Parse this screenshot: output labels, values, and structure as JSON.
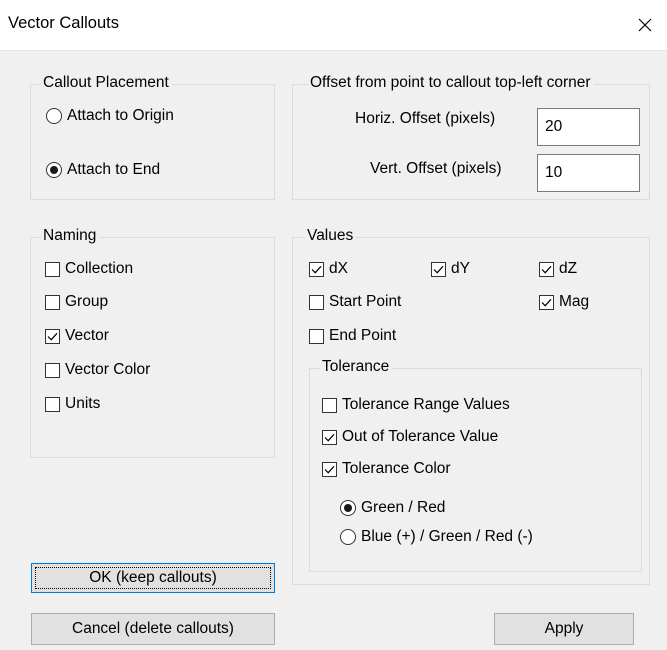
{
  "window": {
    "title": "Vector Callouts"
  },
  "placement": {
    "legend": "Callout Placement",
    "options": [
      {
        "label": "Attach to Origin",
        "selected": false
      },
      {
        "label": "Attach to End",
        "selected": true
      }
    ]
  },
  "offset": {
    "legend": "Offset from point to callout top-left corner",
    "horiz_label": "Horiz. Offset (pixels)",
    "horiz_value": "20",
    "vert_label": "Vert. Offset (pixels)",
    "vert_value": "10"
  },
  "naming": {
    "legend": "Naming",
    "items": [
      {
        "label": "Collection",
        "checked": false
      },
      {
        "label": "Group",
        "checked": false
      },
      {
        "label": "Vector",
        "checked": true
      },
      {
        "label": "Vector Color",
        "checked": false
      },
      {
        "label": "Units",
        "checked": false
      }
    ]
  },
  "values": {
    "legend": "Values",
    "dx": {
      "label": "dX",
      "checked": true
    },
    "dy": {
      "label": "dY",
      "checked": true
    },
    "dz": {
      "label": "dZ",
      "checked": true
    },
    "start_point": {
      "label": "Start Point",
      "checked": false
    },
    "mag": {
      "label": "Mag",
      "checked": true
    },
    "end_point": {
      "label": "End Point",
      "checked": false
    }
  },
  "tolerance": {
    "legend": "Tolerance",
    "range_values": {
      "label": "Tolerance Range Values",
      "checked": false
    },
    "out_of_tolerance": {
      "label": "Out of Tolerance Value",
      "checked": true
    },
    "color": {
      "label": "Tolerance Color",
      "checked": true
    },
    "color_options": [
      {
        "label": "Green / Red",
        "selected": true
      },
      {
        "label": "Blue (+) / Green / Red (-)",
        "selected": false
      }
    ]
  },
  "buttons": {
    "ok": "OK (keep callouts)",
    "cancel": "Cancel (delete callouts)",
    "apply": "Apply"
  }
}
